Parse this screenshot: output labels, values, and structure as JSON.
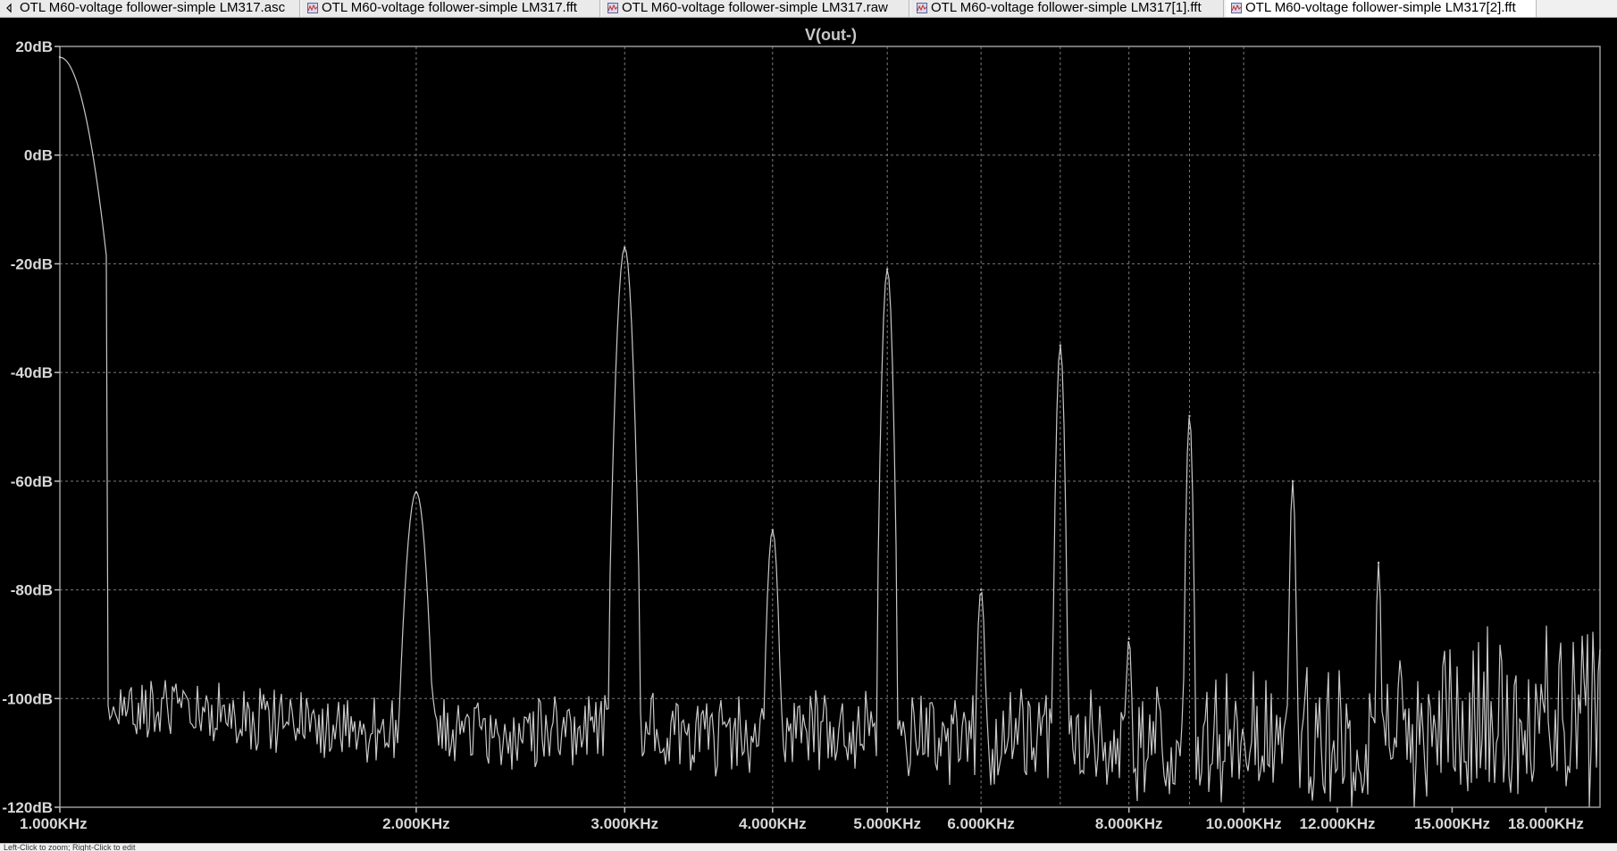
{
  "tabs": [
    {
      "label": "OTL M60-voltage follower-simple LM317.asc",
      "icon": "schematic-icon",
      "active": false
    },
    {
      "label": "OTL M60-voltage follower-simple LM317.fft",
      "icon": "waveform-icon",
      "active": false
    },
    {
      "label": "OTL M60-voltage follower-simple LM317.raw",
      "icon": "waveform-icon",
      "active": false
    },
    {
      "label": "OTL M60-voltage follower-simple LM317[1].fft",
      "icon": "waveform-icon",
      "active": false
    },
    {
      "label": "OTL M60-voltage follower-simple LM317[2].fft",
      "icon": "waveform-icon",
      "active": true
    }
  ],
  "status": {
    "text": "Left-Click to zoom; Right-Click to edit"
  },
  "colors": {
    "background": "#000000",
    "trace": "#c8c8c8",
    "grid": "#7a7a7a",
    "axis_text": "#d8d8d8"
  },
  "chart_data": {
    "type": "line",
    "title": "V(out-)",
    "xlabel": "",
    "ylabel": "",
    "xscale": "log",
    "xlim": [
      1000,
      20000
    ],
    "ylim": [
      -120,
      20
    ],
    "grid": true,
    "x_ticks": [
      {
        "value": 1000,
        "label": "1.000KHz"
      },
      {
        "value": 2000,
        "label": "2.000KHz"
      },
      {
        "value": 3000,
        "label": "3.000KHz"
      },
      {
        "value": 4000,
        "label": "4.000KHz"
      },
      {
        "value": 5000,
        "label": "5.000KHz"
      },
      {
        "value": 6000,
        "label": "6.000KHz"
      },
      {
        "value": 8000,
        "label": "8.000KHz"
      },
      {
        "value": 10000,
        "label": "10.000KHz"
      },
      {
        "value": 12000,
        "label": "12.000KHz"
      },
      {
        "value": 15000,
        "label": "15.000KHz"
      },
      {
        "value": 18000,
        "label": "18.000KHz"
      }
    ],
    "x_grid": [
      1000,
      2000,
      3000,
      4000,
      5000,
      6000,
      7000,
      8000,
      9000,
      10000,
      20000
    ],
    "y_ticks": [
      {
        "value": 20,
        "label": "20dB"
      },
      {
        "value": 0,
        "label": "0dB"
      },
      {
        "value": -20,
        "label": "-20dB"
      },
      {
        "value": -40,
        "label": "-40dB"
      },
      {
        "value": -60,
        "label": "-60dB"
      },
      {
        "value": -80,
        "label": "-80dB"
      },
      {
        "value": -100,
        "label": "-100dB"
      },
      {
        "value": -120,
        "label": "-120dB"
      }
    ],
    "series": [
      {
        "name": "V(out-)",
        "fundamental": {
          "x": 1000,
          "y": 18
        },
        "harmonics": [
          {
            "x": 2000,
            "y": -62
          },
          {
            "x": 3000,
            "y": -17
          },
          {
            "x": 4000,
            "y": -69
          },
          {
            "x": 5000,
            "y": -21
          },
          {
            "x": 6000,
            "y": -80
          },
          {
            "x": 7000,
            "y": -35
          },
          {
            "x": 8000,
            "y": -89
          },
          {
            "x": 9000,
            "y": -48
          },
          {
            "x": 11000,
            "y": -60
          },
          {
            "x": 13000,
            "y": -75
          }
        ],
        "noise_floor": [
          {
            "x": 1000,
            "y": -101
          },
          {
            "x": 2000,
            "y": -106
          },
          {
            "x": 5000,
            "y": -107
          },
          {
            "x": 10000,
            "y": -108
          },
          {
            "x": 15000,
            "y": -105
          },
          {
            "x": 20000,
            "y": -102
          }
        ]
      }
    ]
  }
}
